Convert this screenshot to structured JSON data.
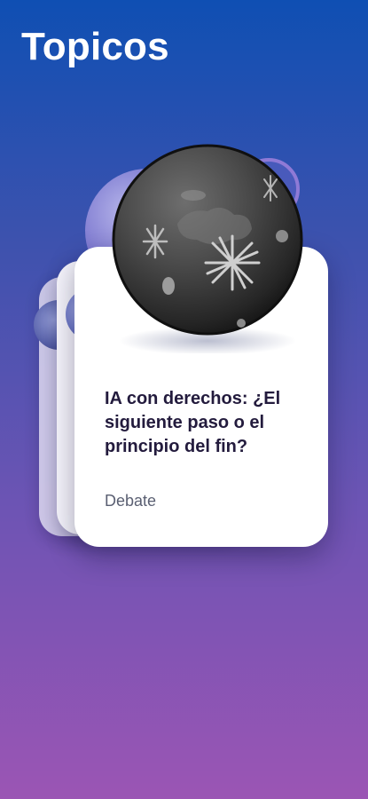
{
  "header": {
    "title": "Topicos"
  },
  "topic_card": {
    "title": "IA con derechos: ¿El siguiente paso o el principio del fin?",
    "category": "Debate"
  },
  "colors": {
    "background_top": "#0f4fb3",
    "background_bottom": "#9b55b4",
    "card_background": "#ffffff",
    "title_text": "#231b3d",
    "planet_dark": "#3a3a3a"
  },
  "icons": {
    "planet": "moon-planet-icon"
  }
}
